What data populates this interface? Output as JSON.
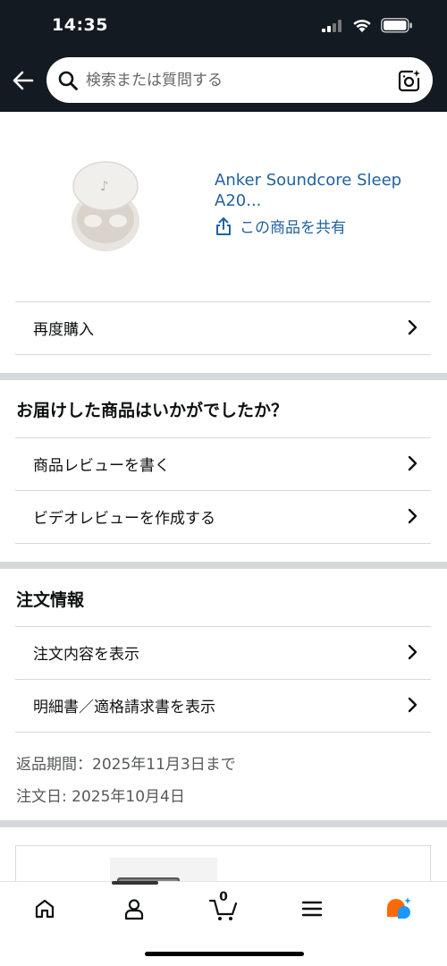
{
  "status_bar": {
    "time": "14:35"
  },
  "header": {
    "search_placeholder": "検索または質問する"
  },
  "product": {
    "title": "Anker Soundcore Sleep A20...",
    "share_label": "この商品を共有"
  },
  "buy_again_label": "再度購入",
  "review_section": {
    "title": "お届けした商品はいかがでしたか？",
    "write_review_label": "商品レビューを書く",
    "video_review_label": "ビデオレビューを作成する"
  },
  "order_section": {
    "title": "注文情報",
    "view_order_label": "注文内容を表示",
    "view_invoice_label": "明細書／適格請求書を表示",
    "return_period": "返品期間：2025年11月3日まで",
    "order_date": "注文日: 2025年10月4日"
  },
  "bottom_nav": {
    "cart_count": "0",
    "items": [
      "home-icon",
      "account-icon",
      "cart-icon",
      "menu-icon",
      "rufus-icon"
    ]
  },
  "colors": {
    "header_bg": "#131a22",
    "link": "#2162a1",
    "divider": "#d5d9d9",
    "rufus_orange": "#ff6a00",
    "rufus_blue": "#1a98ff"
  }
}
